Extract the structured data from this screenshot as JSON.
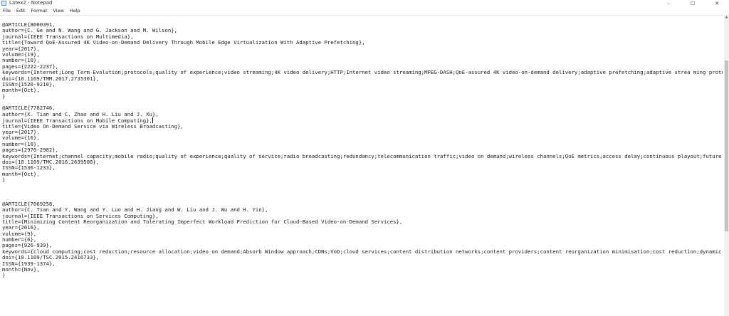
{
  "window": {
    "title": "Latex2 - Notepad",
    "icon": "notepad-icon",
    "controls": {
      "minimize": "–",
      "maximize": "☐",
      "close": "✕"
    }
  },
  "menu": [
    "File",
    "Edit",
    "Format",
    "View",
    "Help"
  ],
  "editor": {
    "lines": [
      "@ARTICLE{8000391,",
      "author={C. Ge and N. Wang and G. Jackson and M. Wilson},",
      "journal={IEEE Transactions on Multimedia},",
      "title={Toward QoE-Assured 4K Video-on-Demand Delivery Through Mobile Edge Virtualization With Adaptive Prefetching},",
      "year={2017},",
      "volume={19},",
      "number={10},",
      "pages={2222-2237},",
      "keywords={Internet;Long Term Evolution;protocols;quality of experience;video streaming;4K video delivery;HTTP;Internet video streaming;MPEG-DASH;QoE-assured 4K video-on-demand delivery;adaptive prefetching;adaptive strea ming protocols;d",
      "doi={10.1109/TMM.2017.2735301},",
      "ISSN={1520-9210},",
      "month={Oct},",
      "}",
      "",
      "@ARTICLE{7782746,",
      "author={X. Tian and C. Zhao and H. Liu and J. Xu},",
      "journal={IEEE Transactions on Mobile Computing},",
      "title={Video On-Demand Service via Wireless Broadcasting},",
      "year={2017},",
      "volume={16},",
      "number={10},",
      "pages={2970-2982},",
      "keywords={Internet;channel capacity;mobile radio;quality of experience;quality of service;radio broadcasting;redundancy;telecommunication traffic;video on demand;wireless channels;QoE metrics;access delay;continuous playout;future traffi",
      "doi={10.1109/TMC.2016.2639500},",
      "ISSN={1536-1233},",
      "month={Oct},",
      "}",
      "",
      "",
      "",
      "@ARTICLE{7069258,",
      "author={C. Tian and Y. Wang and Y. Luo and H. Jiang and W. Liu and J. Wu and H. Yin},",
      "journal={IEEE Transactions on Services Computing},",
      "title={Minimizing Content Reorganization and Tolerating Imperfect Workload Prediction for Cloud-Based Video-on-Demand Services},",
      "year={2016},",
      "volume={9},",
      "number={6},",
      "pages={926-939},",
      "keywords={cloud computing;cost reduction;resource allocation;video on demand;Absorb Window approach;CDNs;VoD;cloud services;content distribution networks;content providers;content reorganization minimisation;cost reduction;dynamic server",
      "doi={10.1109/TSC.2015.2416733},",
      "ISSN={1939-1374},",
      "month={Nov},",
      "}"
    ],
    "caret_line": 16
  }
}
